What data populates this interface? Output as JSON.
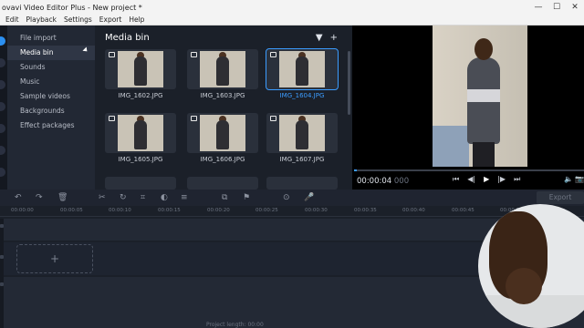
{
  "window": {
    "title": "ovavi Video Editor Plus - New project *",
    "controls": {
      "minimize": "—",
      "maximize": "☐",
      "close": "✕"
    }
  },
  "menu": [
    "Edit",
    "Playback",
    "Settings",
    "Export",
    "Help"
  ],
  "import_categories": [
    {
      "label": "File import",
      "active": false
    },
    {
      "label": "Media bin",
      "active": true
    },
    {
      "label": "Sounds",
      "active": false
    },
    {
      "label": "Music",
      "active": false
    },
    {
      "label": "Sample videos",
      "active": false
    },
    {
      "label": "Backgrounds",
      "active": false
    },
    {
      "label": "Effect packages",
      "active": false
    }
  ],
  "media_bin": {
    "title": "Media bin",
    "filter_icon": "▼",
    "add_icon": "+",
    "items": [
      {
        "name": "IMG_1602.JPG",
        "selected": false
      },
      {
        "name": "IMG_1603.JPG",
        "selected": false
      },
      {
        "name": "IMG_1604.JPG",
        "selected": true
      },
      {
        "name": "IMG_1605.JPG",
        "selected": false
      },
      {
        "name": "IMG_1606.JPG",
        "selected": false
      },
      {
        "name": "IMG_1607.JPG",
        "selected": false
      }
    ]
  },
  "player": {
    "timecode": "00:00:04",
    "timecode_ms": "000",
    "transport": {
      "prev": "⏮",
      "step_back": "◀|",
      "play": "▶",
      "step_forward": "|▶",
      "next": "⏭"
    },
    "volume_icon": "🔈",
    "snapshot_icon": "📷",
    "progress": 0.01
  },
  "toolbar": {
    "undo": "↶",
    "redo": "↷",
    "delete": "🗑",
    "cut": "✂",
    "rotate": "↻",
    "crop": "⌗",
    "color": "◐",
    "properties": "≡",
    "transition": "⧉",
    "marker": "⚑",
    "sticker": "⊙",
    "audio": "🎤",
    "export_label": "Export"
  },
  "ruler": [
    "00:00:00",
    "00:00:05",
    "00:00:10",
    "00:00:15",
    "00:00:20",
    "00:00:25",
    "00:00:30",
    "00:00:35",
    "00:00:40",
    "00:00:45",
    "00:00:50"
  ],
  "timeline": {
    "drop_label": "+",
    "footer_text": "Project length: 00:00"
  },
  "colors": {
    "accent": "#3b9cff",
    "background": "#1b2029",
    "panel": "#222834"
  }
}
